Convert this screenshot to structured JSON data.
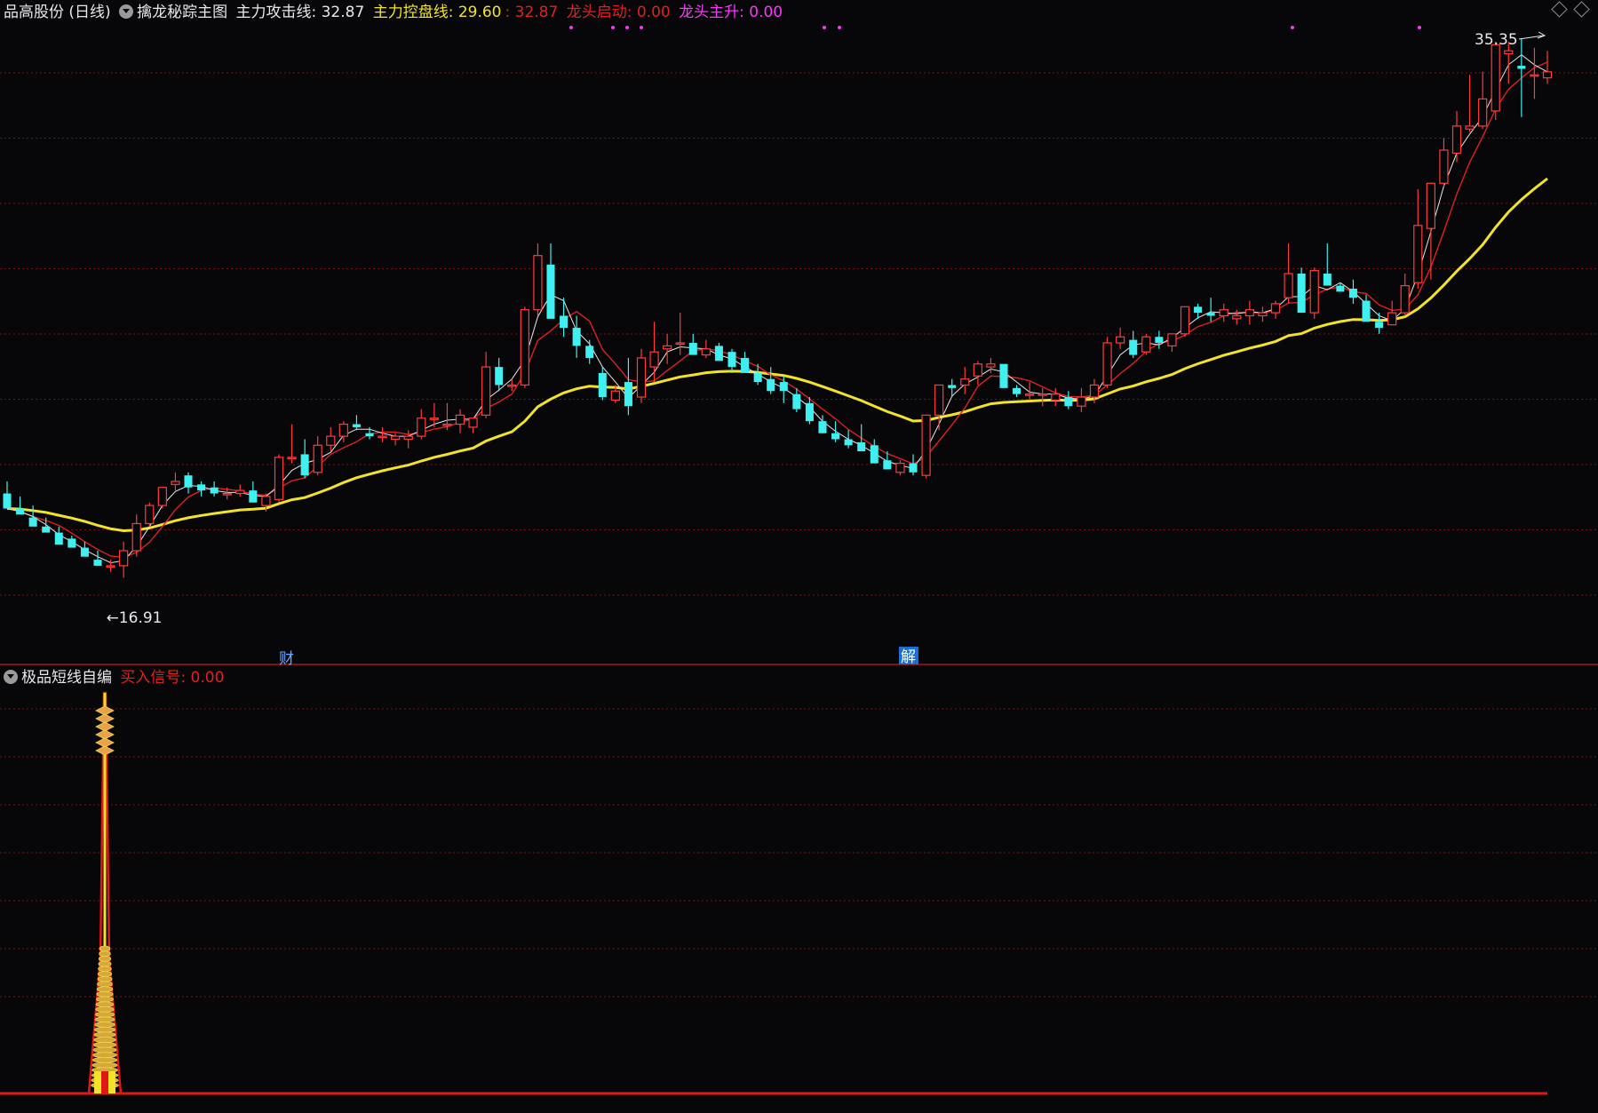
{
  "header": {
    "stock_title": "品高股份 (日线)",
    "indicator_name": "擒龙秘踪主图",
    "line1_label": "主力攻击线: 32.87",
    "line2_label": "主力控盘线: 29.60",
    "line2_extra": ": 32.87",
    "line3_label": "龙头启动: 0.00",
    "line4_label": "龙头主升: 0.00"
  },
  "sub_header": {
    "indicator_name": "极品短线自编",
    "signal_label": "买入信号: 0.00"
  },
  "markers": {
    "low_label": "←16.91",
    "high_label": "35.35",
    "cai_label": "财",
    "jie_label": "解"
  },
  "colors": {
    "up": "#ff3b3b",
    "down": "#3ff0f0",
    "ma_white": "#e8e8e8",
    "ma_red": "#e02020",
    "ma_yellow": "#f2e32a",
    "grid": "#7a1010",
    "magenta": "#ff33ff",
    "label_white": "#e8e8e8"
  },
  "chart_data": [
    {
      "type": "candlestick",
      "title": "擒龙秘踪主图",
      "ylim": [
        15.5,
        36.5
      ],
      "candles": [
        [
          21.0,
          21.4,
          20.8,
          20.5
        ],
        [
          20.5,
          20.9,
          20.3,
          20.3
        ],
        [
          20.2,
          20.6,
          20.0,
          19.9
        ],
        [
          19.9,
          20.2,
          19.8,
          19.7
        ],
        [
          19.7,
          19.9,
          19.5,
          19.3
        ],
        [
          19.5,
          19.6,
          19.3,
          19.2
        ],
        [
          19.2,
          19.4,
          19.0,
          18.9
        ],
        [
          18.8,
          19.1,
          18.6,
          18.6
        ],
        [
          18.6,
          18.8,
          18.4,
          18.6
        ],
        [
          18.6,
          19.4,
          18.2,
          19.1
        ],
        [
          19.1,
          20.3,
          18.9,
          20.0
        ],
        [
          20.0,
          20.7,
          19.9,
          20.6
        ],
        [
          20.6,
          21.2,
          20.5,
          21.2
        ],
        [
          21.3,
          21.7,
          21.1,
          21.4
        ],
        [
          21.6,
          21.7,
          21.0,
          21.2
        ],
        [
          21.3,
          21.4,
          20.9,
          21.1
        ],
        [
          21.2,
          21.4,
          20.9,
          21.0
        ],
        [
          21.0,
          21.2,
          20.8,
          21.0
        ],
        [
          21.0,
          21.3,
          20.9,
          21.1
        ],
        [
          21.1,
          21.4,
          20.7,
          20.7
        ],
        [
          20.6,
          21.0,
          20.4,
          20.9
        ],
        [
          20.8,
          22.3,
          20.7,
          22.2
        ],
        [
          22.2,
          23.3,
          22.0,
          22.2
        ],
        [
          22.3,
          22.8,
          21.5,
          21.6
        ],
        [
          21.7,
          22.9,
          21.6,
          22.6
        ],
        [
          22.6,
          23.2,
          22.4,
          22.9
        ],
        [
          22.9,
          23.4,
          22.7,
          23.3
        ],
        [
          23.3,
          23.6,
          23.1,
          23.2
        ],
        [
          23.0,
          23.2,
          22.8,
          22.9
        ],
        [
          22.9,
          23.2,
          22.7,
          22.9
        ],
        [
          22.8,
          23.0,
          22.6,
          22.9
        ],
        [
          22.8,
          23.1,
          22.5,
          22.9
        ],
        [
          22.9,
          23.8,
          22.8,
          23.5
        ],
        [
          23.5,
          24.0,
          23.2,
          23.5
        ],
        [
          23.3,
          24.0,
          23.1,
          23.3
        ],
        [
          23.3,
          23.8,
          23.0,
          23.6
        ],
        [
          23.2,
          23.5,
          23.0,
          23.5
        ],
        [
          23.6,
          25.7,
          23.5,
          25.2
        ],
        [
          25.2,
          25.5,
          24.4,
          24.6
        ],
        [
          24.6,
          24.8,
          24.4,
          24.6
        ],
        [
          24.6,
          27.2,
          24.5,
          27.1
        ],
        [
          27.1,
          29.3,
          26.9,
          28.9
        ],
        [
          28.6,
          29.3,
          28.5,
          26.8
        ],
        [
          26.9,
          27.5,
          26.2,
          26.5
        ],
        [
          26.5,
          26.9,
          25.5,
          25.9
        ],
        [
          25.9,
          26.1,
          25.3,
          25.5
        ],
        [
          25.0,
          25.2,
          24.1,
          24.2
        ],
        [
          24.1,
          24.6,
          24.0,
          24.4
        ],
        [
          24.7,
          25.5,
          23.6,
          23.9
        ],
        [
          24.2,
          25.8,
          24.0,
          25.5
        ],
        [
          25.2,
          26.7,
          24.7,
          25.7
        ],
        [
          25.8,
          26.3,
          25.3,
          25.9
        ],
        [
          26.0,
          27.0,
          25.6,
          26.0
        ],
        [
          26.0,
          26.3,
          25.6,
          25.6
        ],
        [
          25.6,
          26.1,
          25.5,
          25.8
        ],
        [
          25.9,
          26.0,
          25.4,
          25.4
        ],
        [
          25.7,
          25.8,
          25.0,
          25.2
        ],
        [
          25.5,
          25.7,
          25.2,
          25.0
        ],
        [
          25.0,
          25.3,
          24.6,
          24.7
        ],
        [
          24.8,
          25.2,
          24.3,
          24.4
        ],
        [
          24.7,
          24.9,
          24.0,
          24.4
        ],
        [
          24.3,
          24.5,
          23.7,
          23.8
        ],
        [
          24.0,
          24.2,
          23.3,
          23.4
        ],
        [
          23.4,
          23.6,
          23.0,
          23.0
        ],
        [
          23.0,
          23.4,
          22.7,
          22.8
        ],
        [
          22.8,
          23.1,
          22.5,
          22.6
        ],
        [
          22.7,
          23.3,
          22.4,
          22.4
        ],
        [
          22.6,
          22.8,
          22.0,
          22.0
        ],
        [
          22.1,
          22.4,
          21.8,
          21.8
        ],
        [
          21.7,
          22.1,
          21.6,
          22.0
        ],
        [
          22.0,
          22.3,
          21.6,
          21.7
        ],
        [
          21.6,
          23.6,
          21.5,
          23.6
        ],
        [
          23.6,
          24.6,
          23.1,
          24.6
        ],
        [
          24.6,
          24.8,
          24.2,
          24.5
        ],
        [
          24.6,
          25.2,
          24.3,
          24.8
        ],
        [
          24.9,
          25.4,
          24.6,
          25.3
        ],
        [
          25.2,
          25.5,
          25.0,
          25.3
        ],
        [
          25.3,
          25.3,
          24.5,
          24.5
        ],
        [
          24.5,
          24.6,
          24.2,
          24.3
        ],
        [
          24.3,
          24.7,
          24.1,
          24.3
        ],
        [
          24.3,
          24.5,
          23.9,
          24.3
        ],
        [
          24.1,
          24.5,
          23.9,
          24.3
        ],
        [
          24.2,
          24.4,
          23.8,
          23.9
        ],
        [
          23.9,
          24.5,
          23.7,
          24.2
        ],
        [
          24.2,
          24.8,
          24.0,
          24.6
        ],
        [
          24.6,
          26.2,
          24.5,
          26.0
        ],
        [
          26.0,
          26.5,
          25.8,
          26.2
        ],
        [
          26.1,
          26.4,
          25.5,
          25.6
        ],
        [
          25.7,
          26.3,
          25.6,
          26.2
        ],
        [
          26.2,
          26.4,
          25.8,
          26.0
        ],
        [
          25.9,
          26.3,
          25.7,
          26.3
        ],
        [
          26.3,
          27.2,
          26.2,
          27.2
        ],
        [
          27.2,
          27.3,
          26.8,
          27.0
        ],
        [
          27.0,
          27.5,
          26.7,
          26.9
        ],
        [
          26.9,
          27.3,
          26.7,
          27.1
        ],
        [
          26.8,
          27.1,
          26.6,
          26.9
        ],
        [
          26.9,
          27.4,
          26.6,
          27.1
        ],
        [
          26.9,
          27.2,
          26.7,
          27.0
        ],
        [
          27.0,
          27.4,
          26.8,
          27.3
        ],
        [
          27.5,
          29.3,
          27.3,
          28.3
        ],
        [
          28.3,
          28.5,
          27.0,
          27.0
        ],
        [
          27.0,
          28.5,
          26.8,
          28.4
        ],
        [
          28.3,
          29.3,
          28.0,
          27.9
        ],
        [
          27.9,
          28.0,
          27.7,
          27.7
        ],
        [
          27.8,
          28.1,
          27.3,
          27.5
        ],
        [
          27.4,
          27.6,
          26.8,
          26.7
        ],
        [
          26.7,
          27.0,
          26.3,
          26.5
        ],
        [
          26.6,
          27.4,
          26.6,
          27.0
        ],
        [
          27.0,
          28.3,
          26.9,
          27.9
        ],
        [
          28.0,
          31.1,
          27.8,
          29.9
        ],
        [
          29.8,
          30.8,
          28.1,
          31.3
        ],
        [
          31.3,
          32.8,
          31.2,
          32.4
        ],
        [
          32.3,
          33.7,
          32.0,
          33.2
        ],
        [
          33.1,
          34.9,
          33.0,
          33.2
        ],
        [
          33.2,
          35.0,
          33.1,
          34.1
        ],
        [
          33.7,
          36.0,
          33.4,
          35.9
        ],
        [
          35.6,
          36.0,
          34.6,
          35.7
        ],
        [
          35.2,
          36.1,
          33.5,
          35.1
        ],
        [
          34.9,
          35.8,
          34.1,
          34.9
        ],
        [
          34.8,
          35.7,
          34.6,
          35.0
        ]
      ]
    },
    {
      "type": "bar",
      "title": "极品短线自编",
      "series": [
        {
          "name": "买入信号",
          "values": [
            0.0
          ]
        }
      ]
    }
  ]
}
